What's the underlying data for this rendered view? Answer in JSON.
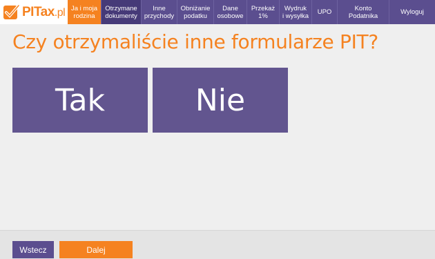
{
  "brand": {
    "name_part1": "PITax",
    "name_part2": ".pl",
    "accent": "#f58220",
    "primary": "#5b4e8f"
  },
  "nav": [
    {
      "label": "Ja i moja\nrodzina",
      "state": "orange"
    },
    {
      "label": "Otrzymane\ndokumenty",
      "state": "active"
    },
    {
      "label": "Inne\nprzychody",
      "state": ""
    },
    {
      "label": "Obniżanie\npodatku",
      "state": ""
    },
    {
      "label": "Dane\nosobowe",
      "state": ""
    },
    {
      "label": "Przekaż\n1%",
      "state": ""
    },
    {
      "label": "Wydruk\ni wysyłka",
      "state": ""
    },
    {
      "label": "UPO",
      "state": ""
    },
    {
      "label": "Konto\nPodatnika",
      "state": ""
    },
    {
      "label": "Wyloguj",
      "state": ""
    }
  ],
  "question": "Czy otrzymaliście inne formularze PIT?",
  "answers": {
    "yes": "Tak",
    "no": "Nie"
  },
  "footer": {
    "back_label": "Wstecz",
    "next_label": "Dalej"
  }
}
